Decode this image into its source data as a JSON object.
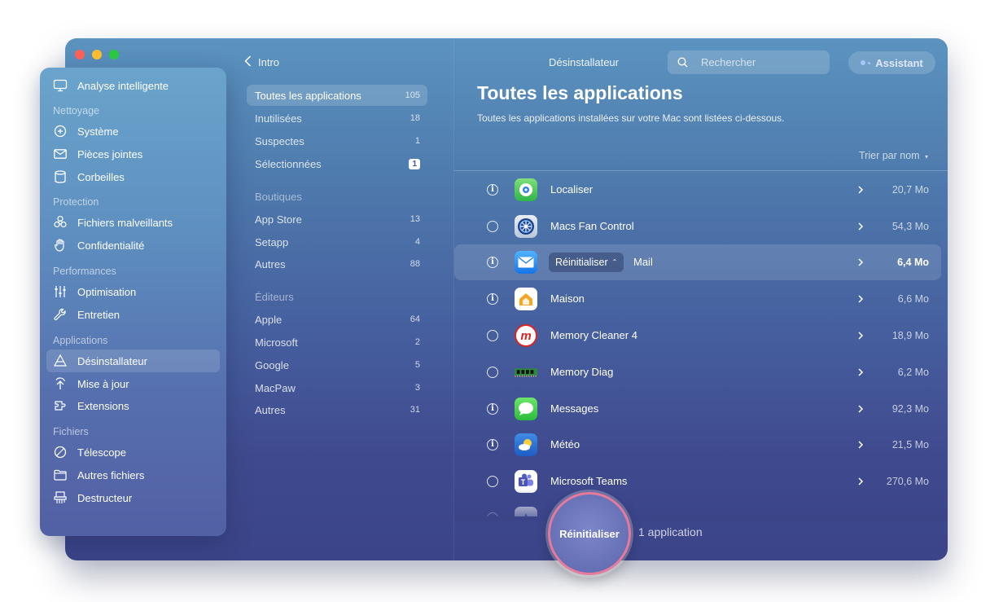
{
  "window": {
    "title": "Désinstallateur",
    "back_label": "Intro",
    "search_placeholder": "Rechercher",
    "assistant_label": "Assistant"
  },
  "sidebar": {
    "top_item": {
      "label": "Analyse intelligente",
      "icon": "monitor-icon"
    },
    "sections": [
      {
        "title": "Nettoyage",
        "items": [
          {
            "label": "Système",
            "icon": "system-icon"
          },
          {
            "label": "Pièces jointes",
            "icon": "mail-attachment-icon"
          },
          {
            "label": "Corbeilles",
            "icon": "trash-icon"
          }
        ]
      },
      {
        "title": "Protection",
        "items": [
          {
            "label": "Fichiers malveillants",
            "icon": "biohazard-icon"
          },
          {
            "label": "Confidentialité",
            "icon": "hand-icon"
          }
        ]
      },
      {
        "title": "Performances",
        "items": [
          {
            "label": "Optimisation",
            "icon": "sliders-icon"
          },
          {
            "label": "Entretien",
            "icon": "wrench-icon"
          }
        ]
      },
      {
        "title": "Applications",
        "items": [
          {
            "label": "Désinstallateur",
            "icon": "apps-icon",
            "active": true
          },
          {
            "label": "Mise à jour",
            "icon": "update-icon"
          },
          {
            "label": "Extensions",
            "icon": "extensions-icon"
          }
        ]
      },
      {
        "title": "Fichiers",
        "items": [
          {
            "label": "Télescope",
            "icon": "lens-icon"
          },
          {
            "label": "Autres fichiers",
            "icon": "folder-icon"
          },
          {
            "label": "Destructeur",
            "icon": "shredder-icon"
          }
        ]
      }
    ]
  },
  "filters": {
    "main": [
      {
        "label": "Toutes les applications",
        "count": "105",
        "active": true
      },
      {
        "label": "Inutilisées",
        "count": "18"
      },
      {
        "label": "Suspectes",
        "count": "1"
      },
      {
        "label": "Sélectionnées",
        "count": "1",
        "boxed": true
      }
    ],
    "stores_title": "Boutiques",
    "stores": [
      {
        "label": "App Store",
        "count": "13"
      },
      {
        "label": "Setapp",
        "count": "4"
      },
      {
        "label": "Autres",
        "count": "88"
      }
    ],
    "vendors_title": "Éditeurs",
    "vendors": [
      {
        "label": "Apple",
        "count": "64"
      },
      {
        "label": "Microsoft",
        "count": "2"
      },
      {
        "label": "Google",
        "count": "5"
      },
      {
        "label": "MacPaw",
        "count": "3"
      },
      {
        "label": "Autres",
        "count": "31"
      }
    ]
  },
  "main": {
    "title": "Toutes les applications",
    "subtitle": "Toutes les applications installées sur votre Mac sont listées ci-dessous.",
    "sort_label": "Trier par nom",
    "reset_pill_label": "Réinitialiser",
    "apps": [
      {
        "name": "Localiser",
        "size": "20,7 Mo",
        "marker": "info",
        "icon": "find-my-icon"
      },
      {
        "name": "Macs Fan Control",
        "size": "54,3 Mo",
        "marker": "circle",
        "icon": "fan-icon"
      },
      {
        "name": "Mail",
        "size": "6,4 Mo",
        "marker": "info",
        "icon": "mail-icon",
        "selected": true
      },
      {
        "name": "Maison",
        "size": "6,6 Mo",
        "marker": "info",
        "icon": "home-icon"
      },
      {
        "name": "Memory Cleaner 4",
        "size": "18,9 Mo",
        "marker": "circle",
        "icon": "memory-cleaner-icon"
      },
      {
        "name": "Memory Diag",
        "size": "6,2 Mo",
        "marker": "circle",
        "icon": "ram-icon"
      },
      {
        "name": "Messages",
        "size": "92,3 Mo",
        "marker": "info",
        "icon": "messages-icon"
      },
      {
        "name": "Météo",
        "size": "21,5 Mo",
        "marker": "info",
        "icon": "weather-icon"
      },
      {
        "name": "Microsoft Teams",
        "size": "270,6 Mo",
        "marker": "circle",
        "icon": "teams-icon"
      },
      {
        "name": "",
        "size": "",
        "marker": "circle",
        "icon": "app-icon"
      }
    ]
  },
  "footer": {
    "action_label": "Réinitialiser",
    "selection_count": "1 application"
  },
  "colors": {
    "accent_ring": "#e77a9c",
    "window_top": "#5b93bf",
    "window_bottom": "#3b4488"
  }
}
